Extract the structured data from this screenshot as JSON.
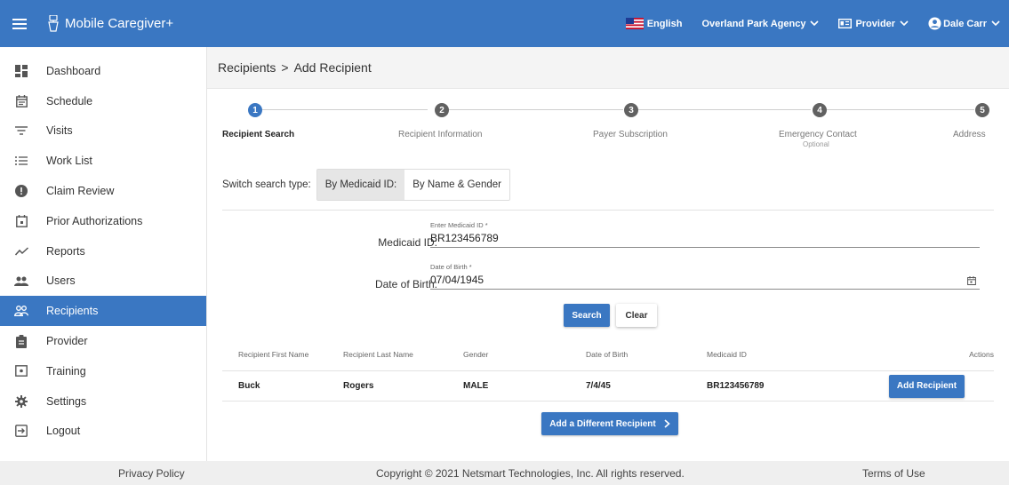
{
  "header": {
    "app_title": "Mobile Caregiver+",
    "language": "English",
    "agency": "Overland Park Agency",
    "role": "Provider",
    "user": "Dale Carr"
  },
  "sidebar": {
    "items": [
      {
        "label": "Dashboard",
        "icon": "dashboard-icon"
      },
      {
        "label": "Schedule",
        "icon": "schedule-icon"
      },
      {
        "label": "Visits",
        "icon": "visits-icon"
      },
      {
        "label": "Work List",
        "icon": "work-list-icon"
      },
      {
        "label": "Claim Review",
        "icon": "claim-review-icon"
      },
      {
        "label": "Prior Authorizations",
        "icon": "prior-authorizations-icon"
      },
      {
        "label": "Reports",
        "icon": "reports-icon"
      },
      {
        "label": "Users",
        "icon": "users-icon"
      },
      {
        "label": "Recipients",
        "icon": "recipients-icon",
        "active": true
      },
      {
        "label": "Provider",
        "icon": "provider-icon"
      },
      {
        "label": "Training",
        "icon": "training-icon"
      },
      {
        "label": "Settings",
        "icon": "settings-icon"
      },
      {
        "label": "Logout",
        "icon": "logout-icon"
      }
    ]
  },
  "breadcrumb": {
    "parent": "Recipients",
    "separator": ">",
    "current": "Add Recipient"
  },
  "stepper": {
    "steps": [
      {
        "number": "1",
        "label": "Recipient Search",
        "active": true
      },
      {
        "number": "2",
        "label": "Recipient Information"
      },
      {
        "number": "3",
        "label": "Payer Subscription"
      },
      {
        "number": "4",
        "label": "Emergency Contact",
        "sublabel": "Optional"
      },
      {
        "number": "5",
        "label": "Address"
      }
    ]
  },
  "search_type": {
    "label": "Switch search type:",
    "options": [
      "By Medicaid ID:",
      "By Name & Gender"
    ],
    "selected": "By Medicaid ID:"
  },
  "form": {
    "medicaid_label": "Medicaid ID:",
    "medicaid_hint": "Enter Medicaid ID *",
    "medicaid_value": "BR123456789",
    "dob_label": "Date of Birth:",
    "dob_hint": "Date of Birth *",
    "dob_value": "07/04/1945",
    "search_button": "Search",
    "clear_button": "Clear"
  },
  "results": {
    "columns": [
      "Recipient First Name",
      "Recipient Last Name",
      "Gender",
      "Date of Birth",
      "Medicaid ID",
      "Actions"
    ],
    "rows": [
      {
        "first_name": "Buck",
        "last_name": "Rogers",
        "gender": "MALE",
        "dob": "7/4/45",
        "medicaid_id": "BR123456789",
        "action": "Add Recipient"
      }
    ],
    "add_different": "Add a Different Recipient"
  },
  "footer": {
    "privacy": "Privacy Policy",
    "copyright": "Copyright © 2021 Netsmart Technologies, Inc. All rights reserved.",
    "terms": "Terms of Use"
  },
  "colors": {
    "primary": "#3a77c2",
    "step_inactive": "#616161"
  }
}
